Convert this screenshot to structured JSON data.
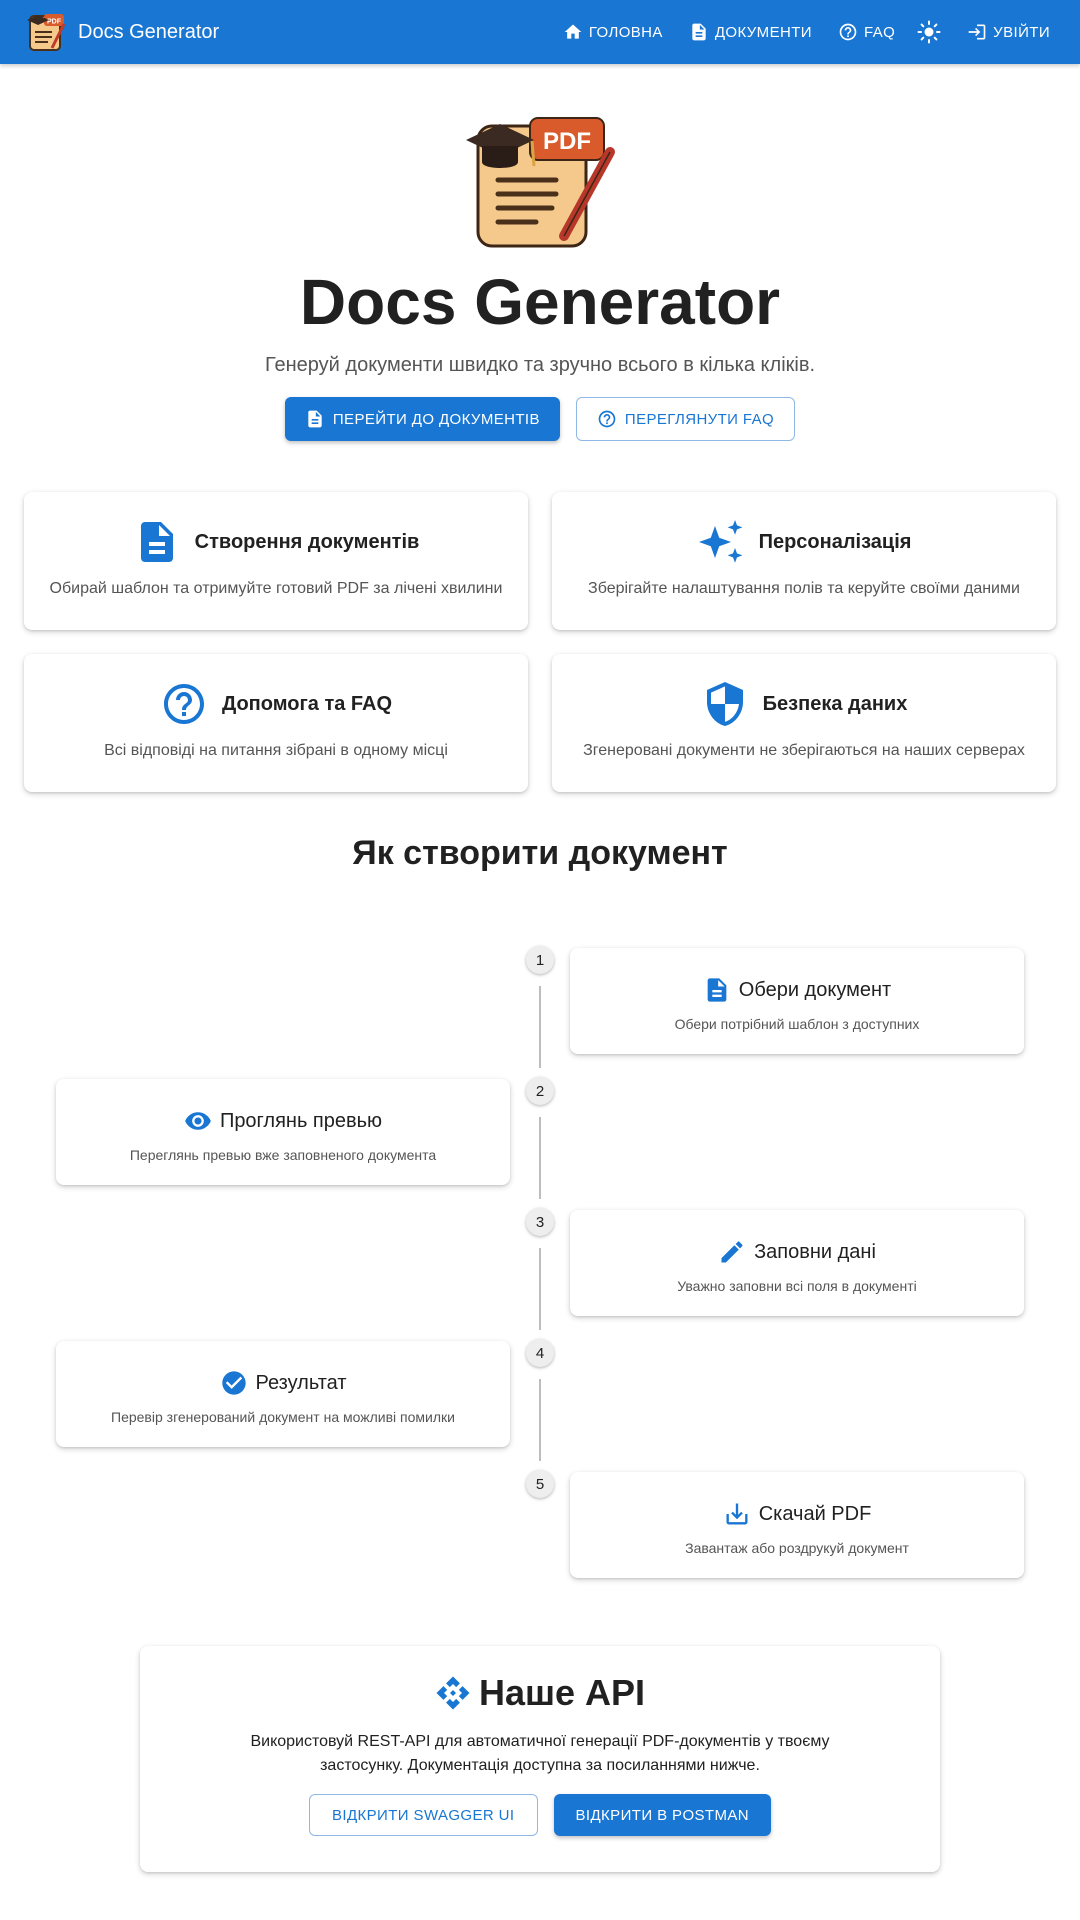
{
  "app": {
    "title": "Docs Generator",
    "accent": "#1976d2"
  },
  "nav": {
    "home": "ГОЛОВНА",
    "documents": "ДОКУМЕНТИ",
    "faq": "FAQ",
    "theme_icon": "sun-icon",
    "login": "УВІЙТИ"
  },
  "hero": {
    "logo_text": "PDF",
    "title": "Docs Generator",
    "subtitle": "Генеруй документи швидко та зручно всього в кілька кліків.",
    "primary_button": "ПЕРЕЙТИ ДО ДОКУМЕНТІВ",
    "secondary_button": "ПЕРЕГЛЯНУТИ FAQ"
  },
  "features": [
    {
      "icon": "document-icon",
      "title": "Створення документів",
      "desc": "Обирай шаблон та отримуйте готовий PDF за лічені хвилини"
    },
    {
      "icon": "sparkle-icon",
      "title": "Персоналізація",
      "desc": "Зберігайте налаштування полів та керуйте своїми даними"
    },
    {
      "icon": "help-icon",
      "title": "Допомога та FAQ",
      "desc": "Всі відповіді на питання зібрані в одному місці"
    },
    {
      "icon": "shield-icon",
      "title": "Безпека даних",
      "desc": "Згенеровані документи не зберігаються на наших серверах"
    }
  ],
  "steps_section": {
    "title": "Як створити документ",
    "steps": [
      {
        "num": "1",
        "icon": "document-icon",
        "title": "Обери документ",
        "desc": "Обери потрібний шаблон з доступних"
      },
      {
        "num": "2",
        "icon": "eye-icon",
        "title": "Проглянь превью",
        "desc": "Переглянь превью вже заповненого документа"
      },
      {
        "num": "3",
        "icon": "pencil-icon",
        "title": "Заповни дані",
        "desc": "Уважно заповни всі поля в документі"
      },
      {
        "num": "4",
        "icon": "check-circle-icon",
        "title": "Результат",
        "desc": "Перевір згенерований документ на можливі помилки"
      },
      {
        "num": "5",
        "icon": "download-icon",
        "title": "Скачай PDF",
        "desc": "Завантаж або роздрукуй документ"
      }
    ]
  },
  "api": {
    "icon": "api-icon",
    "title": "Наше API",
    "desc": "Використовуй REST-API для автоматичної генерації PDF-документів у твоєму застосунку. Документація доступна за посиланнями нижче.",
    "swagger_button": "ВІДКРИТИ SWAGGER UI",
    "postman_button": "ВІДКРИТИ В POSTMAN"
  }
}
